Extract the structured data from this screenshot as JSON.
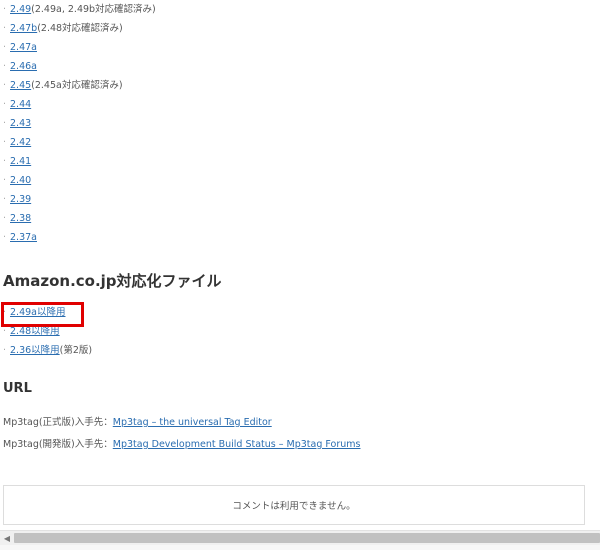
{
  "versions": [
    {
      "link": "2.49",
      "note": "(2.49a, 2.49b対応確認済み)"
    },
    {
      "link": "2.47b",
      "note": "(2.48対応確認済み)"
    },
    {
      "link": "2.47a",
      "note": ""
    },
    {
      "link": "2.46a",
      "note": ""
    },
    {
      "link": "2.45",
      "note": "(2.45a対応確認済み)"
    },
    {
      "link": "2.44",
      "note": ""
    },
    {
      "link": "2.43",
      "note": ""
    },
    {
      "link": "2.42",
      "note": ""
    },
    {
      "link": "2.41",
      "note": ""
    },
    {
      "link": "2.40",
      "note": ""
    },
    {
      "link": "2.39",
      "note": ""
    },
    {
      "link": "2.38",
      "note": ""
    },
    {
      "link": "2.37a",
      "note": ""
    }
  ],
  "amazon": {
    "title": "Amazon.co.jp対応化ファイル",
    "items": [
      {
        "link": "2.49a以降用",
        "note": ""
      },
      {
        "link": "2.48以降用",
        "note": ""
      },
      {
        "link": "2.36以降用",
        "note": "(第2版)"
      }
    ]
  },
  "url_section": {
    "title": "URL",
    "lines": [
      {
        "label": "Mp3tag(正式版)入手先：",
        "link": "Mp3tag – the universal Tag Editor"
      },
      {
        "label": "Mp3tag(開発版)入手先：",
        "link": "Mp3tag Development Build Status – Mp3tag Forums"
      }
    ]
  },
  "comments": {
    "closed_text": "コメントは利用できません。"
  },
  "colors": {
    "link": "#2a6db0",
    "highlight": "#e00000"
  },
  "icons": {
    "scroll_left": "triangle-left"
  }
}
